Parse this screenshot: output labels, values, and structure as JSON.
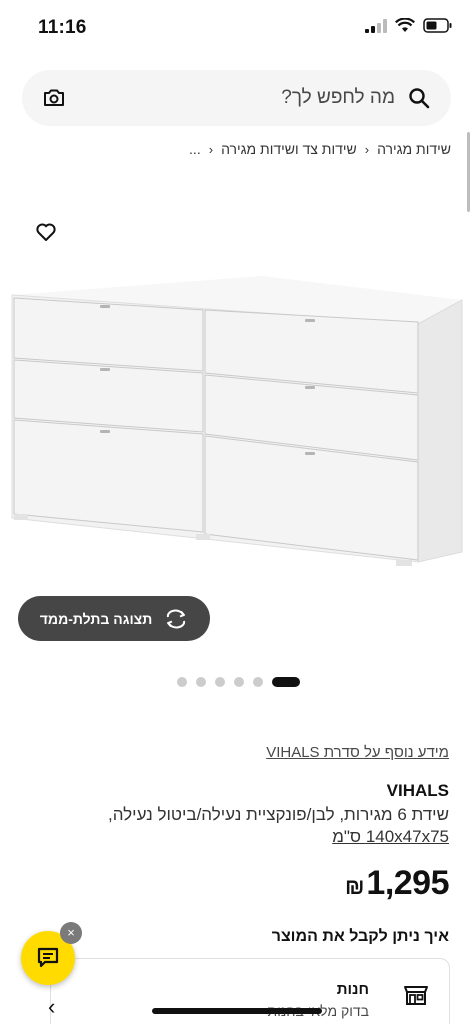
{
  "status_bar": {
    "time": "11:16"
  },
  "search": {
    "placeholder": "מה לחפש לך?"
  },
  "breadcrumb": {
    "items": [
      "שידות צד ושידות מגירה",
      "שידות מגירה"
    ],
    "ellipsis": "..."
  },
  "gallery": {
    "view_3d_label": "תצוגה בתלת-ממד",
    "total_images": 6,
    "active_index": 0
  },
  "product": {
    "series_link": "מידע נוסף על סדרת VIHALS",
    "name": "VIHALS",
    "description": "שידת 6 מגירות, לבן/פונקציית נעילה/ביטול נעילה,",
    "size": "140x47x75 ס\"מ",
    "price": "1,295",
    "currency": "₪"
  },
  "delivery": {
    "heading": "איך ניתן לקבל את המוצר",
    "store_title": "חנות",
    "store_subtitle": "בדוק מלאי בחנות"
  },
  "chat": {
    "close_glyph": "×"
  },
  "nav": {
    "back_glyph": "‹"
  },
  "colors": {
    "chat_yellow": "#ffdb00",
    "dark_button": "#464646",
    "text": "#111111"
  },
  "icons": [
    "camera-icon",
    "search-icon",
    "heart-icon",
    "rotate-3d-icon",
    "store-icon",
    "chat-icon"
  ]
}
